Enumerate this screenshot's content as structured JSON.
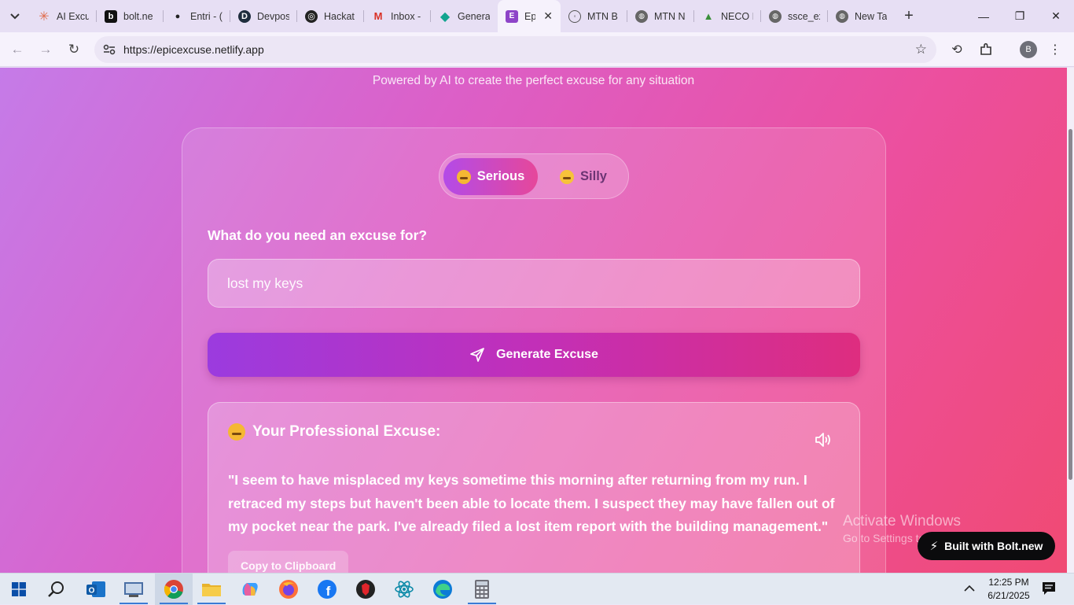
{
  "browser": {
    "tabs": [
      {
        "title": "AI Excu",
        "favicon": "asterisk-icon",
        "color": "#e06b4b"
      },
      {
        "title": "bolt.ne",
        "favicon": "bolt-b-icon",
        "color": "#111111"
      },
      {
        "title": "Entri - (",
        "favicon": "entri-icon",
        "color": "#222222"
      },
      {
        "title": "Devpos",
        "favicon": "devpost-icon",
        "color": "#1f2d3d"
      },
      {
        "title": "Hackat",
        "favicon": "hackathon-icon",
        "color": "#222222"
      },
      {
        "title": "Inbox -",
        "favicon": "gmail-icon",
        "color": "#d93025"
      },
      {
        "title": "Genera",
        "favicon": "diamond-icon",
        "color": "#12a48f"
      },
      {
        "title": "Ep",
        "favicon": "epic-icon",
        "color": "#8e44c8",
        "active": true
      },
      {
        "title": "MTN B",
        "favicon": "mtn-icon",
        "color": "#555555"
      },
      {
        "title": "MTN N",
        "favicon": "globe-icon",
        "color": "#555555"
      },
      {
        "title": "NECO I",
        "favicon": "neco-icon",
        "color": "#3a8f3a"
      },
      {
        "title": "ssce_ex",
        "favicon": "globe-icon",
        "color": "#555555"
      },
      {
        "title": "New Ta",
        "favicon": "chrome-icon",
        "color": "#555555"
      }
    ],
    "url": "https://epicexcuse.netlify.app",
    "profile_initial": "B"
  },
  "page": {
    "tagline": "Powered by AI to create the perfect excuse for any situation",
    "mode_toggle": {
      "serious_label": "Serious",
      "silly_label": "Silly",
      "selected": "Serious"
    },
    "question_label": "What do you need an excuse for?",
    "input_value": "lost my keys",
    "generate_label": "Generate Excuse",
    "result": {
      "title": "Your Professional Excuse:",
      "excuse": "\"I seem to have misplaced my keys sometime this morning after returning from my run. I retraced my steps but haven't been able to locate them. I suspect they may have fallen out of my pocket near the park. I've already filed a lost item report with the building management.\"",
      "copy_label": "Copy to Clipboard"
    },
    "badge_label": "Built with Bolt.new"
  },
  "watermark": {
    "line1": "Activate Windows",
    "line2": "Go to Settings to activate Windows."
  },
  "taskbar": {
    "apps": [
      "windows-start-icon",
      "search-icon",
      "outlook-icon",
      "virtualbox-icon",
      "chrome-icon",
      "file-explorer-icon",
      "copilot-icon",
      "firefox-icon",
      "facebook-icon",
      "brave-like-icon",
      "react-icon",
      "edge-icon",
      "calculator-icon"
    ],
    "time": "12:25 PM",
    "date": "6/21/2025"
  },
  "colors": {
    "accent_purple": "#9b3bdf",
    "accent_pink": "#de2d7f",
    "chrome_bg": "#e7dff4"
  }
}
